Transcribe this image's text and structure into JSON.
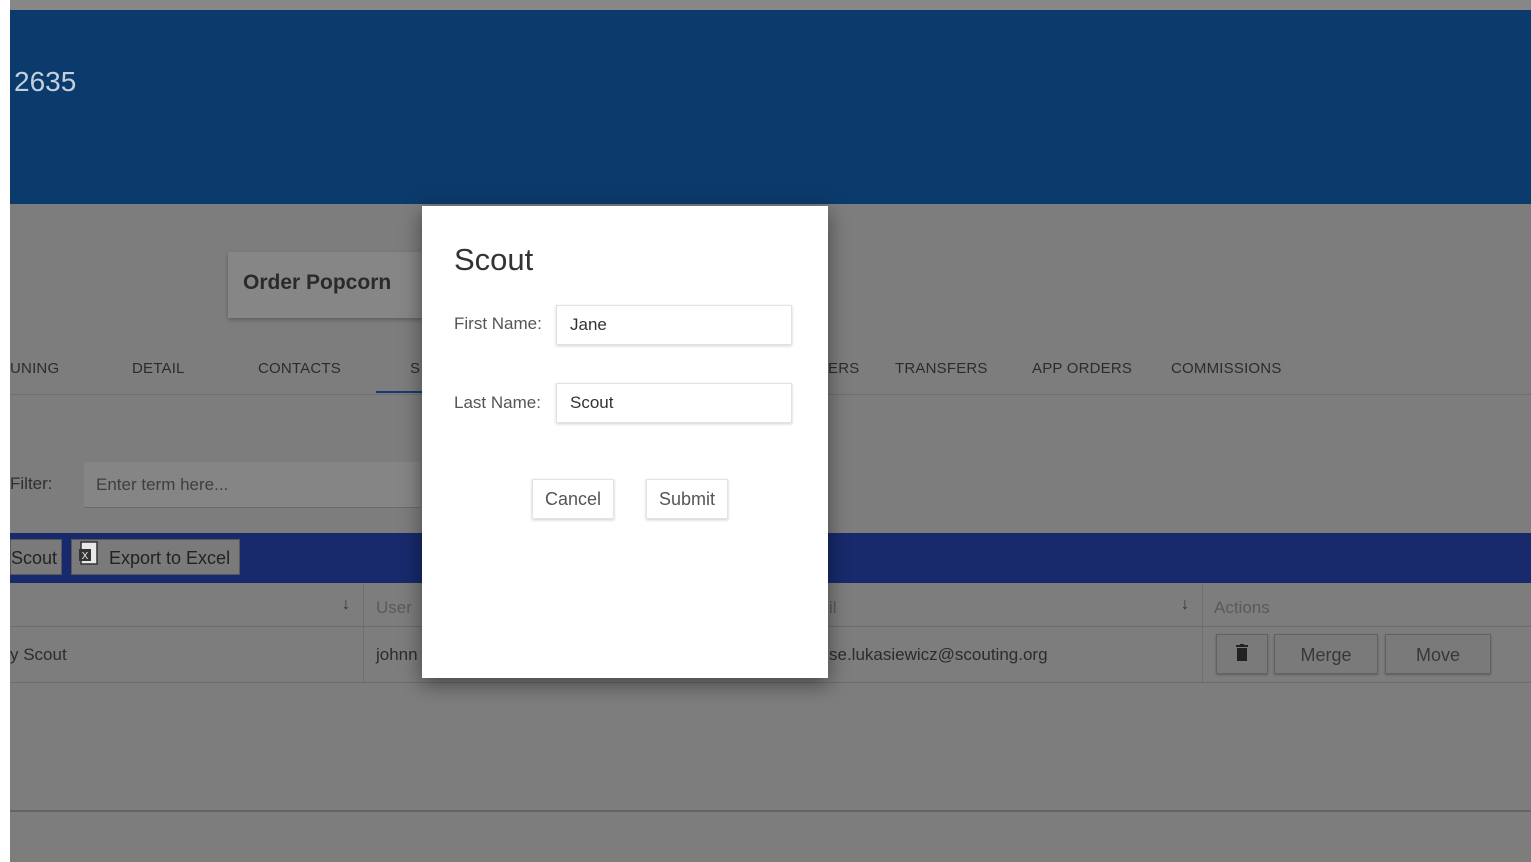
{
  "header": {
    "title": "2635"
  },
  "order_card": {
    "label": "Order Popcorn"
  },
  "tabs": [
    {
      "label": "UNING"
    },
    {
      "label": "DETAIL"
    },
    {
      "label": "CONTACTS"
    },
    {
      "label": "S"
    },
    {
      "label": "ERS"
    },
    {
      "label": "TRANSFERS"
    },
    {
      "label": "APP ORDERS"
    },
    {
      "label": "COMMISSIONS"
    }
  ],
  "filter": {
    "label": "Filter:",
    "placeholder": "Enter term here..."
  },
  "toolbar": {
    "add_scout_label": "Scout",
    "export_label": "Export to Excel",
    "export_icon": "excel-file-icon"
  },
  "grid": {
    "headers": {
      "user": "User",
      "email": "il",
      "actions": "Actions"
    },
    "sort_icon": "↓",
    "rows": [
      {
        "name": "y Scout",
        "user": "johnn",
        "email": "se.lukasiewicz@scouting.org"
      }
    ],
    "actions": {
      "delete_icon": "trash-icon",
      "merge_label": "Merge",
      "move_label": "Move"
    }
  },
  "modal": {
    "title": "Scout",
    "first_name_label": "First Name:",
    "first_name_value": "Jane",
    "last_name_label": "Last Name:",
    "last_name_value": "Scout",
    "cancel_label": "Cancel",
    "submit_label": "Submit"
  },
  "colors": {
    "header_bg": "#0b3a6c",
    "toolbar_bg": "#182a6c",
    "overlay": "#7d7d7d",
    "modal_bg": "#ffffff"
  }
}
